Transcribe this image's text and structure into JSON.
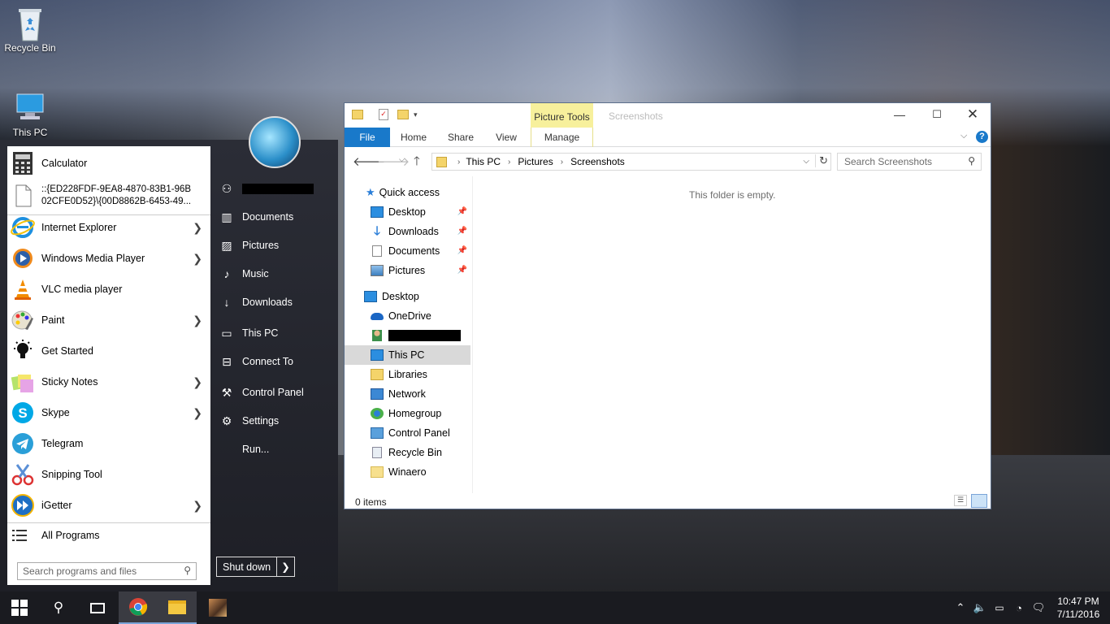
{
  "desktop": {
    "icons": [
      {
        "label": "Recycle Bin"
      },
      {
        "label": "This PC"
      }
    ]
  },
  "start_menu": {
    "programs": [
      {
        "label": "Calculator",
        "has_submenu": false,
        "icon": "calculator-icon"
      },
      {
        "label": "::{ED228FDF-9EA8-4870-83B1-96B\n02CFE0D52}\\{00D8862B-6453-49...",
        "has_submenu": false,
        "icon": "file-icon"
      },
      {
        "label": "Internet Explorer",
        "has_submenu": true,
        "icon": "ie-icon"
      },
      {
        "label": "Windows Media Player",
        "has_submenu": true,
        "icon": "media-player-icon"
      },
      {
        "label": "VLC media player",
        "has_submenu": false,
        "icon": "vlc-icon"
      },
      {
        "label": "Paint",
        "has_submenu": true,
        "icon": "paint-icon"
      },
      {
        "label": "Get Started",
        "has_submenu": false,
        "icon": "lightbulb-icon"
      },
      {
        "label": "Sticky Notes",
        "has_submenu": true,
        "icon": "sticky-notes-icon"
      },
      {
        "label": "Skype",
        "has_submenu": true,
        "icon": "skype-icon"
      },
      {
        "label": "Telegram",
        "has_submenu": false,
        "icon": "telegram-icon"
      },
      {
        "label": "Snipping Tool",
        "has_submenu": false,
        "icon": "scissors-icon"
      },
      {
        "label": "iGetter",
        "has_submenu": true,
        "icon": "igetter-icon"
      }
    ],
    "all_programs": "All Programs",
    "search_placeholder": "Search programs and files",
    "right_items": [
      {
        "label": "Documents"
      },
      {
        "label": "Pictures"
      },
      {
        "label": "Music"
      },
      {
        "label": "Downloads"
      },
      {
        "label": "This PC"
      },
      {
        "label": "Connect To"
      },
      {
        "label": "Control Panel"
      },
      {
        "label": "Settings"
      },
      {
        "label": "Run..."
      }
    ],
    "shutdown_label": "Shut down",
    "shutdown_arrow": "❯"
  },
  "explorer": {
    "context_tab": "Picture Tools",
    "title": "Screenshots",
    "tabs": {
      "file": "File",
      "home": "Home",
      "share": "Share",
      "view": "View",
      "manage": "Manage"
    },
    "breadcrumb": [
      "This PC",
      "Pictures",
      "Screenshots"
    ],
    "search_placeholder": "Search Screenshots",
    "empty_message": "This folder is empty.",
    "nav": {
      "quick_access": "Quick access",
      "pinned": [
        {
          "label": "Desktop"
        },
        {
          "label": "Downloads"
        },
        {
          "label": "Documents"
        },
        {
          "label": "Pictures"
        }
      ],
      "tree": [
        {
          "label": "Desktop"
        },
        {
          "label": "OneDrive"
        },
        {
          "label": ""
        },
        {
          "label": "This PC"
        },
        {
          "label": "Libraries"
        },
        {
          "label": "Network"
        },
        {
          "label": "Homegroup"
        },
        {
          "label": "Control Panel"
        },
        {
          "label": "Recycle Bin"
        },
        {
          "label": "Winaero"
        }
      ]
    },
    "status": "0 items"
  },
  "taskbar": {
    "time": "10:47 PM",
    "date": "7/11/2016"
  },
  "colors": {
    "accent": "#1979ca",
    "context_tab_bg": "#f7f09c",
    "selected_nav": "#d9d9d9"
  }
}
